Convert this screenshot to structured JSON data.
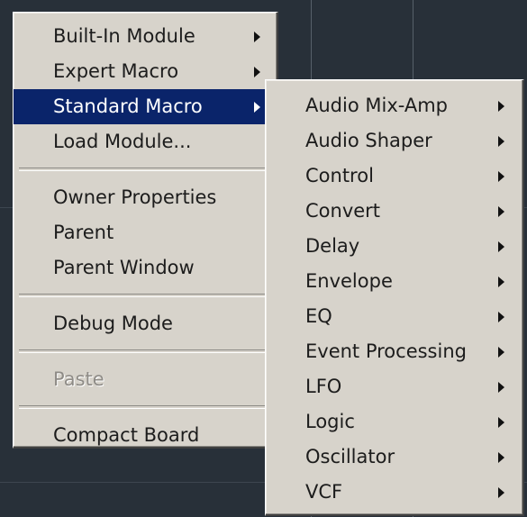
{
  "main_menu": {
    "group1": [
      {
        "label": "Built-In Module",
        "submenu": true
      },
      {
        "label": "Expert Macro",
        "submenu": true
      },
      {
        "label": "Standard Macro",
        "submenu": true,
        "active": true
      },
      {
        "label": "Load Module...",
        "submenu": false
      }
    ],
    "group2": [
      {
        "label": "Owner Properties"
      },
      {
        "label": "Parent"
      },
      {
        "label": "Parent Window"
      }
    ],
    "group3": [
      {
        "label": "Debug Mode"
      }
    ],
    "group4": [
      {
        "label": "Paste",
        "disabled": true
      }
    ],
    "group5": [
      {
        "label": "Compact Board"
      }
    ]
  },
  "sub_menu": {
    "items": [
      {
        "label": "Audio Mix-Amp"
      },
      {
        "label": "Audio Shaper"
      },
      {
        "label": "Control"
      },
      {
        "label": "Convert"
      },
      {
        "label": "Delay"
      },
      {
        "label": "Envelope"
      },
      {
        "label": "EQ"
      },
      {
        "label": "Event Processing"
      },
      {
        "label": "LFO"
      },
      {
        "label": "Logic"
      },
      {
        "label": "Oscillator"
      },
      {
        "label": "VCF"
      }
    ]
  },
  "colors": {
    "menu_background": "#d7d3cb",
    "highlight": "#0a246a",
    "desktop_background": "#283039"
  }
}
